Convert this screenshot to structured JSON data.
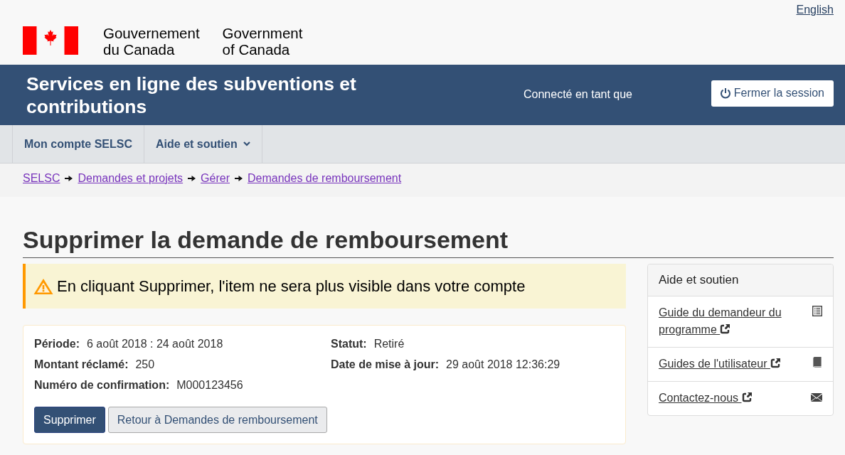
{
  "language_link": "English",
  "signature": [
    {
      "lines": [
        "Gouvernement",
        "du Canada"
      ]
    },
    {
      "lines": [
        "Government",
        "of Canada"
      ]
    }
  ],
  "banner": {
    "title": "Services en ligne des subventions et contributions",
    "signed_in_label": "Connecté en tant que",
    "sign_out_button": "Fermer la session"
  },
  "menu": [
    {
      "label": "Mon compte SELSC",
      "kind": "link"
    },
    {
      "label": "Aide et soutien",
      "kind": "dropdown"
    }
  ],
  "breadcrumb": [
    "SELSC",
    "Demandes et projets",
    "Gérer",
    "Demandes de remboursement"
  ],
  "page_title": "Supprimer la demande de remboursement",
  "warning": "En cliquant Supprimer, l'item ne sera plus visible dans votre compte",
  "details": {
    "left": [
      {
        "label": "Période:",
        "value": "6 août 2018 : 24 août 2018"
      },
      {
        "label": "Montant réclamé:",
        "value": "250"
      },
      {
        "label": "Numéro de confirmation:",
        "value": "M000123456"
      }
    ],
    "right": [
      {
        "label": "Statut:",
        "value": "Retiré"
      },
      {
        "label": "Date de mise à jour:",
        "value": "29 août 2018 12:36:29"
      }
    ]
  },
  "buttons": [
    {
      "label": "Supprimer",
      "kind": "primary"
    },
    {
      "label": "Retour à Demandes de remboursement",
      "kind": "default"
    }
  ],
  "sidebar": {
    "title": "Aide et soutien",
    "links": [
      {
        "label": "Guide du demandeur du programme",
        "kind": "document"
      },
      {
        "label": "Guides de l'utilisateur",
        "kind": "book"
      },
      {
        "label": "Contactez-nous",
        "kind": "email"
      }
    ]
  }
}
